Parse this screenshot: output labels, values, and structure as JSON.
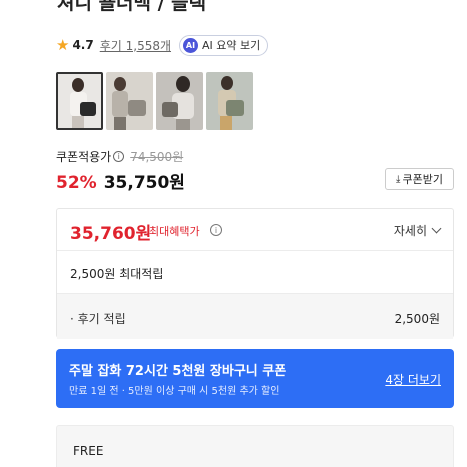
{
  "product": {
    "title": "져니 숄더백 / 블랙",
    "rating": "4.7",
    "reviews_label": "후기 1,558개",
    "ai_badge": "AI",
    "ai_summary_label": "AI 요약 보기"
  },
  "gallery": {
    "selected_index": 0,
    "thumbnails": [
      {
        "colors": [
          "#e9e7e4",
          "#2a2a2a",
          "#c9c3bc"
        ]
      },
      {
        "colors": [
          "#d8d4cd",
          "#8f8a82",
          "#b8b2a9"
        ]
      },
      {
        "colors": [
          "#c4c1bc",
          "#6e6a63",
          "#e5e2de"
        ]
      },
      {
        "colors": [
          "#bfc4bd",
          "#7c8571",
          "#d4c9b2"
        ]
      }
    ]
  },
  "pricing": {
    "coupon_price_label": "쿠폰적용가",
    "info_glyph": "i",
    "original_price": "74,500원",
    "discount": "52%",
    "sale_price": "35,750원",
    "coupon_button_label": "쿠폰받기",
    "download_glyph": "⤓"
  },
  "benefits": {
    "max_benefit_price": "35,760원",
    "max_benefit_label": "최대혜택가",
    "info_glyph": "i",
    "details_label": "자세히",
    "max_points": "2,500원 최대적립",
    "review_points_label": "· 후기 적립",
    "review_points_value": "2,500원"
  },
  "promo_banner": {
    "title": "주말 잡화 72시간 5천원 장바구니 쿠폰",
    "subtitle": "만료 1일 전 · 5만원 이상 구매 시 5천원 추가 할인",
    "link_label": "4장 더보기"
  },
  "shipping": {
    "label": "FREE"
  },
  "colors": {
    "accent_red": "#e0232e",
    "banner_blue": "#2d6ef5",
    "star": "#f5a623",
    "ai_badge": "#4b55d9"
  }
}
